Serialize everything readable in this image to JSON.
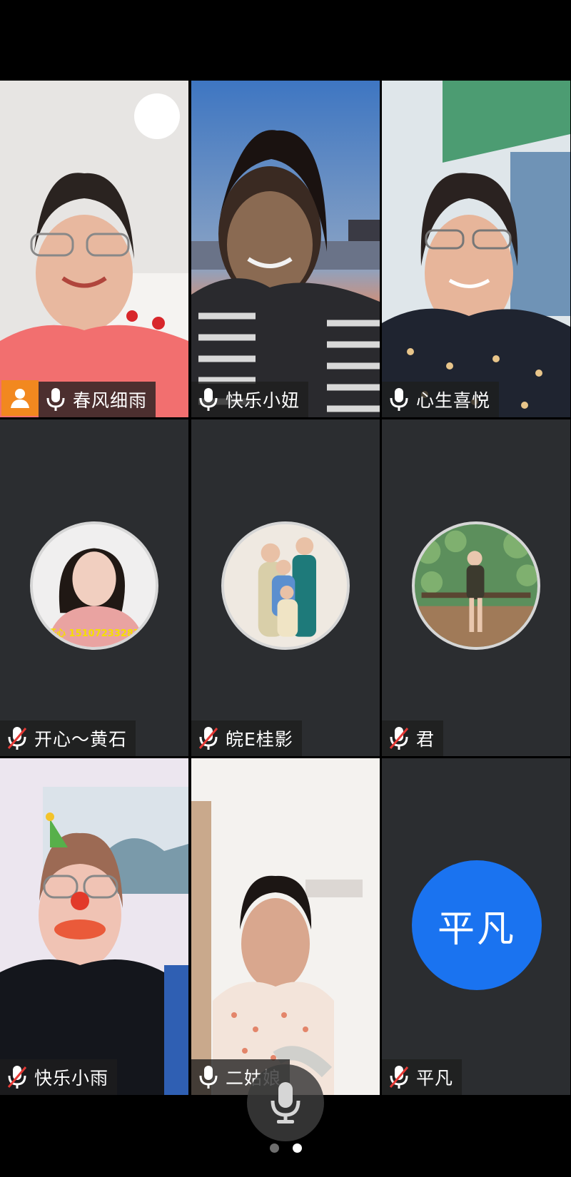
{
  "participants": [
    {
      "name": "春风细雨",
      "mic": "on",
      "host": true,
      "video": true
    },
    {
      "name": "快乐小妞",
      "mic": "on",
      "host": false,
      "video": true
    },
    {
      "name": "心生喜悦",
      "mic": "on",
      "host": false,
      "video": true
    },
    {
      "name": "开心～黄石",
      "mic": "muted",
      "host": false,
      "video": false,
      "avatar_text": "开心 15107233287"
    },
    {
      "name": "皖E桂影",
      "mic": "muted",
      "host": false,
      "video": false
    },
    {
      "name": "君",
      "mic": "muted",
      "host": false,
      "video": false
    },
    {
      "name": "快乐小雨",
      "mic": "muted",
      "host": false,
      "video": true
    },
    {
      "name": "二姑娘",
      "mic": "on",
      "host": false,
      "video": true
    },
    {
      "name": "平凡",
      "mic": "muted",
      "host": false,
      "video": false,
      "initials": "平凡"
    }
  ],
  "controls": {
    "mic_icon": "microphone-icon"
  },
  "pagination": {
    "current": 2,
    "total": 2
  },
  "colors": {
    "active_border": "#2fbf52",
    "host_badge": "#f2881f",
    "initials_bg": "#1a73f0",
    "tile_bg": "#2b2d30",
    "muted": "#e53935"
  }
}
